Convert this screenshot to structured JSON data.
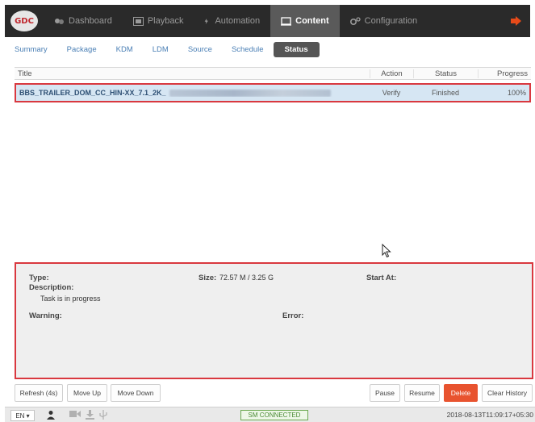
{
  "logo": {
    "text": "GDC"
  },
  "nav": {
    "items": [
      {
        "label": "Dashboard",
        "icon": "dashboard-icon"
      },
      {
        "label": "Playback",
        "icon": "film-icon"
      },
      {
        "label": "Automation",
        "icon": "bolt-icon"
      },
      {
        "label": "Content",
        "icon": "content-icon",
        "active": true
      },
      {
        "label": "Configuration",
        "icon": "gears-icon"
      }
    ],
    "logout_icon": "logout-icon"
  },
  "subtabs": {
    "items": [
      "Summary",
      "Package",
      "KDM",
      "LDM",
      "Source",
      "Schedule",
      "Status"
    ],
    "active": "Status"
  },
  "table": {
    "columns": {
      "title": "Title",
      "action": "Action",
      "status": "Status",
      "progress": "Progress"
    },
    "rows": [
      {
        "title": "BBS_TRAILER_DOM_CC_HIN-XX_7.1_2K_",
        "action": "Verify",
        "status": "Finished",
        "progress": "100%"
      }
    ]
  },
  "details": {
    "type_label": "Type:",
    "description_label": "Description:",
    "description_value": "Task is in progress",
    "size_label": "Size:",
    "size_value": "72.57 M / 3.25 G",
    "start_label": "Start At:",
    "warning_label": "Warning:",
    "error_label": "Error:"
  },
  "buttons": {
    "refresh": "Refresh (4s)",
    "move_up": "Move Up",
    "move_down": "Move Down",
    "pause": "Pause",
    "resume": "Resume",
    "delete": "Delete",
    "clear_history": "Clear History"
  },
  "statusbar": {
    "language": "EN ▾",
    "connection": "SM CONNECTED",
    "datetime": "2018-08-13T11:09:17+05:30"
  },
  "colors": {
    "topbar": "#2a2a2a",
    "highlight": "#d9383f",
    "row_selected": "#d6e6f3",
    "delete": "#e8532f",
    "connected": "#4a8a35"
  }
}
